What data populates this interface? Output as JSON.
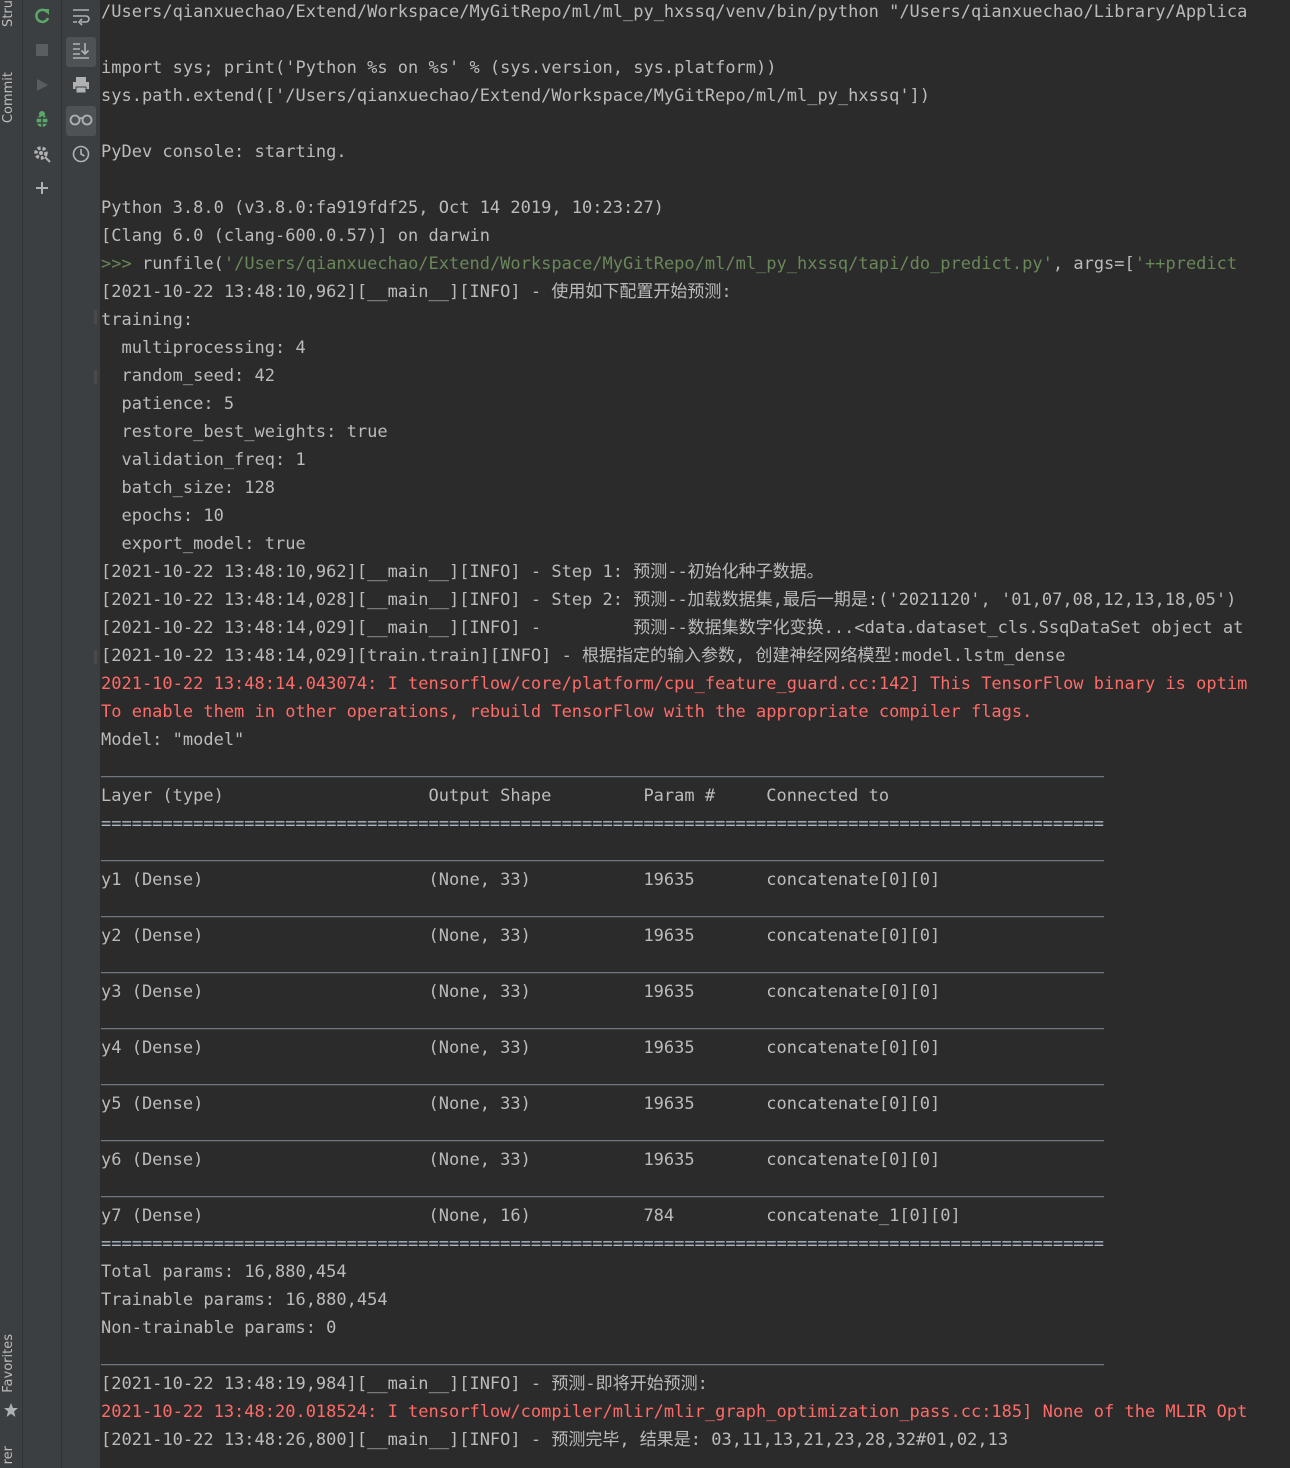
{
  "side_tabs": {
    "structure": "Stru",
    "commit": "Commit",
    "favorites": "Favorites",
    "bottom": "rer"
  },
  "toolbar": {
    "rerun": "rerun-icon",
    "stop": "stop-icon",
    "run": "run-icon",
    "debug": "debug-icon",
    "settings": "settings-icon",
    "add": "add-icon",
    "soft_wrap": "soft-wrap-icon",
    "scroll_end": "scroll-to-end-icon",
    "print": "print-icon",
    "show_vars": "glasses-icon",
    "history": "history-icon"
  },
  "console": {
    "lines": [
      {
        "text": "/Users/qianxuechao/Extend/Workspace/MyGitRepo/ml/ml_py_hxssq/venv/bin/python \"/Users/qianxuechao/Library/Applica",
        "kind": "normal"
      },
      {
        "text": "",
        "kind": "normal"
      },
      {
        "text": "import sys; print('Python %s on %s' % (sys.version, sys.platform))",
        "kind": "normal"
      },
      {
        "text": "sys.path.extend(['/Users/qianxuechao/Extend/Workspace/MyGitRepo/ml/ml_py_hxssq'])",
        "kind": "normal"
      },
      {
        "text": "",
        "kind": "normal"
      },
      {
        "text": "PyDev console: starting.",
        "kind": "normal"
      },
      {
        "text": "",
        "kind": "normal"
      },
      {
        "text": "Python 3.8.0 (v3.8.0:fa919fdf25, Oct 14 2019, 10:23:27)",
        "kind": "normal"
      },
      {
        "text": "[Clang 6.0 (clang-600.0.57)] on darwin",
        "kind": "normal"
      },
      {
        "text": "",
        "kind": "runfile"
      },
      {
        "text": "[2021-10-22 13:48:10,962][__main__][INFO] - 使用如下配置开始预测:",
        "kind": "normal"
      },
      {
        "text": "training:",
        "kind": "normal"
      },
      {
        "text": "  multiprocessing: 4",
        "kind": "normal"
      },
      {
        "text": "  random_seed: 42",
        "kind": "normal"
      },
      {
        "text": "  patience: 5",
        "kind": "normal"
      },
      {
        "text": "  restore_best_weights: true",
        "kind": "normal"
      },
      {
        "text": "  validation_freq: 1",
        "kind": "normal"
      },
      {
        "text": "  batch_size: 128",
        "kind": "normal"
      },
      {
        "text": "  epochs: 10",
        "kind": "normal"
      },
      {
        "text": "  export_model: true",
        "kind": "normal"
      },
      {
        "text": "[2021-10-22 13:48:10,962][__main__][INFO] - Step 1: 预测--初始化种子数据。",
        "kind": "normal"
      },
      {
        "text": "[2021-10-22 13:48:14,028][__main__][INFO] - Step 2: 预测--加载数据集,最后一期是:('2021120', '01,07,08,12,13,18,05')",
        "kind": "normal"
      },
      {
        "text": "[2021-10-22 13:48:14,029][__main__][INFO] -         预测--数据集数字化变换...<data.dataset_cls.SsqDataSet object at",
        "kind": "normal"
      },
      {
        "text": "[2021-10-22 13:48:14,029][train.train][INFO] - 根据指定的输入参数, 创建神经网络模型:model.lstm_dense",
        "kind": "normal"
      },
      {
        "text": "2021-10-22 13:48:14.043074: I tensorflow/core/platform/cpu_feature_guard.cc:142] This TensorFlow binary is optim",
        "kind": "err"
      },
      {
        "text": "To enable them in other operations, rebuild TensorFlow with the appropriate compiler flags.",
        "kind": "err"
      },
      {
        "text": "Model: \"model\"",
        "kind": "normal"
      },
      {
        "text": "__________________________________________________________________________________________________",
        "kind": "sep"
      },
      {
        "text": "Layer (type)                    Output Shape         Param #     Connected to",
        "kind": "normal"
      },
      {
        "text": "==================================================================================================",
        "kind": "sep"
      },
      {
        "text": "__________________________________________________________________________________________________",
        "kind": "sep"
      },
      {
        "text": "y1 (Dense)                      (None, 33)           19635       concatenate[0][0]",
        "kind": "normal"
      },
      {
        "text": "__________________________________________________________________________________________________",
        "kind": "sep"
      },
      {
        "text": "y2 (Dense)                      (None, 33)           19635       concatenate[0][0]",
        "kind": "normal"
      },
      {
        "text": "__________________________________________________________________________________________________",
        "kind": "sep"
      },
      {
        "text": "y3 (Dense)                      (None, 33)           19635       concatenate[0][0]",
        "kind": "normal"
      },
      {
        "text": "__________________________________________________________________________________________________",
        "kind": "sep"
      },
      {
        "text": "y4 (Dense)                      (None, 33)           19635       concatenate[0][0]",
        "kind": "normal"
      },
      {
        "text": "__________________________________________________________________________________________________",
        "kind": "sep"
      },
      {
        "text": "y5 (Dense)                      (None, 33)           19635       concatenate[0][0]",
        "kind": "normal"
      },
      {
        "text": "__________________________________________________________________________________________________",
        "kind": "sep"
      },
      {
        "text": "y6 (Dense)                      (None, 33)           19635       concatenate[0][0]",
        "kind": "normal"
      },
      {
        "text": "__________________________________________________________________________________________________",
        "kind": "sep"
      },
      {
        "text": "y7 (Dense)                      (None, 16)           784         concatenate_1[0][0]",
        "kind": "normal"
      },
      {
        "text": "==================================================================================================",
        "kind": "sep"
      },
      {
        "text": "Total params: 16,880,454",
        "kind": "normal"
      },
      {
        "text": "Trainable params: 16,880,454",
        "kind": "normal"
      },
      {
        "text": "Non-trainable params: 0",
        "kind": "normal"
      },
      {
        "text": "__________________________________________________________________________________________________",
        "kind": "sep"
      },
      {
        "text": "[2021-10-22 13:48:19,984][__main__][INFO] - 预测-即将开始预测:",
        "kind": "normal"
      },
      {
        "text": "2021-10-22 13:48:20.018524: I tensorflow/compiler/mlir/mlir_graph_optimization_pass.cc:185] None of the MLIR Opt",
        "kind": "err"
      },
      {
        "text": "[2021-10-22 13:48:26,800][__main__][INFO] - 预测完毕, 结果是: 03,11,13,21,23,28,32#01,02,13",
        "kind": "normal"
      }
    ],
    "runfile": {
      "prompt": ">>> ",
      "call": "runfile(",
      "path": "'/Users/qianxuechao/Extend/Workspace/MyGitRepo/ml/ml_py_hxssq/tapi/do_predict.py'",
      "middle": ", args=[",
      "arg": "'++predict"
    }
  }
}
